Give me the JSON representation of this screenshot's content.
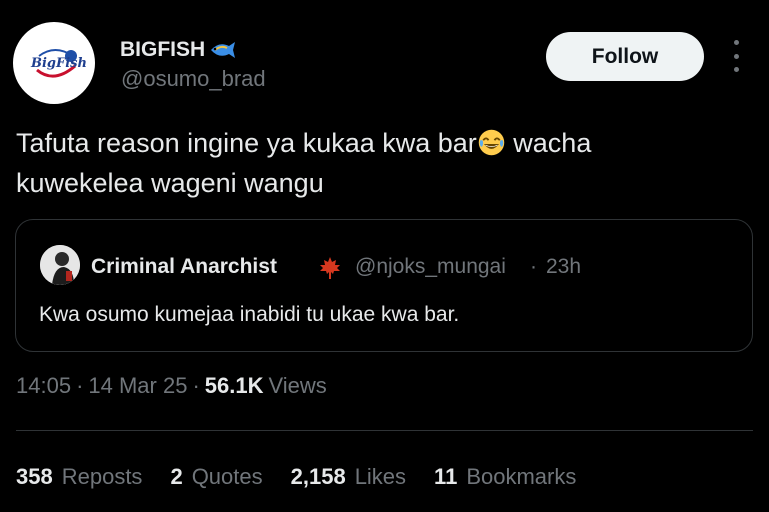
{
  "author": {
    "name": "BIGFISH",
    "handle": "@osumo_brad",
    "avatar_text": "BigFish"
  },
  "follow_label": "Follow",
  "tweet": {
    "text_part1": "Tafuta reason ingine ya kukaa kwa bar",
    "text_part2": " wacha kuwekelea wageni wangu"
  },
  "quote": {
    "name": "Criminal Anarchist",
    "handle": "@njoks_mungai",
    "separator": "·",
    "time": "23h",
    "text": "Kwa osumo kumejaa inabidi tu ukae kwa bar."
  },
  "meta": {
    "time": "14:05",
    "sep": "·",
    "date": "14 Mar 25",
    "views_count": "56.1K",
    "views_label": "Views"
  },
  "stats": [
    {
      "count": "358",
      "label": "Reposts"
    },
    {
      "count": "2",
      "label": "Quotes"
    },
    {
      "count": "2,158",
      "label": "Likes"
    },
    {
      "count": "11",
      "label": "Bookmarks"
    }
  ],
  "icons": {
    "fish": "fish-icon",
    "emoji": "laughing-emoji-icon",
    "leaf": "maple-leaf-icon",
    "more": "more-icon"
  },
  "colors": {
    "background": "#000000",
    "primary_text": "#e7e9ea",
    "secondary_text": "#71767b",
    "border": "#2f3336",
    "follow_bg": "#eff3f4"
  }
}
